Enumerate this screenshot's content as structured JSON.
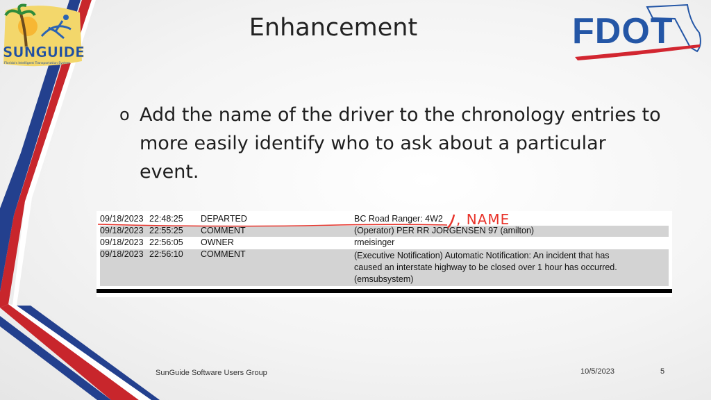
{
  "slide": {
    "title": "Enhancement",
    "bullet_marker": "o",
    "bullet_text": "Add the name of the driver to the chronology entries to more easily identify who to ask about a particular event."
  },
  "logos": {
    "left": {
      "name": "SunGuide",
      "tagline": "Florida's Intelligent Transportation System"
    },
    "right": {
      "name": "FDOT"
    }
  },
  "table": {
    "rows": [
      {
        "date": "09/18/2023",
        "time": "22:48:25",
        "type": "DEPARTED",
        "lines": [
          "BC Road Ranger: 4W2"
        ]
      },
      {
        "date": "09/18/2023",
        "time": "22:55:25",
        "type": "COMMENT",
        "lines": [
          "(Operator) PER RR JORGENSEN 97 (amilton)"
        ]
      },
      {
        "date": "09/18/2023",
        "time": "22:56:05",
        "type": "OWNER",
        "lines": [
          "rmeisinger"
        ]
      },
      {
        "date": "09/18/2023",
        "time": "22:56:10",
        "type": "COMMENT",
        "lines": [
          "(Executive Notification) Automatic Notification: An incident that has",
          "caused an interstate highway to be closed over 1 hour has occurred.",
          "(emsubsystem)"
        ]
      }
    ],
    "annotation": ", NAME",
    "annotation_color": "#e8332a"
  },
  "footer": {
    "group": "SunGuide Software Users Group",
    "date": "10/5/2023",
    "page": "5"
  },
  "colors": {
    "stripe_red": "#c8262c",
    "stripe_blue": "#23408e",
    "fdot_blue": "#2456a6",
    "fdot_red": "#d22630"
  }
}
